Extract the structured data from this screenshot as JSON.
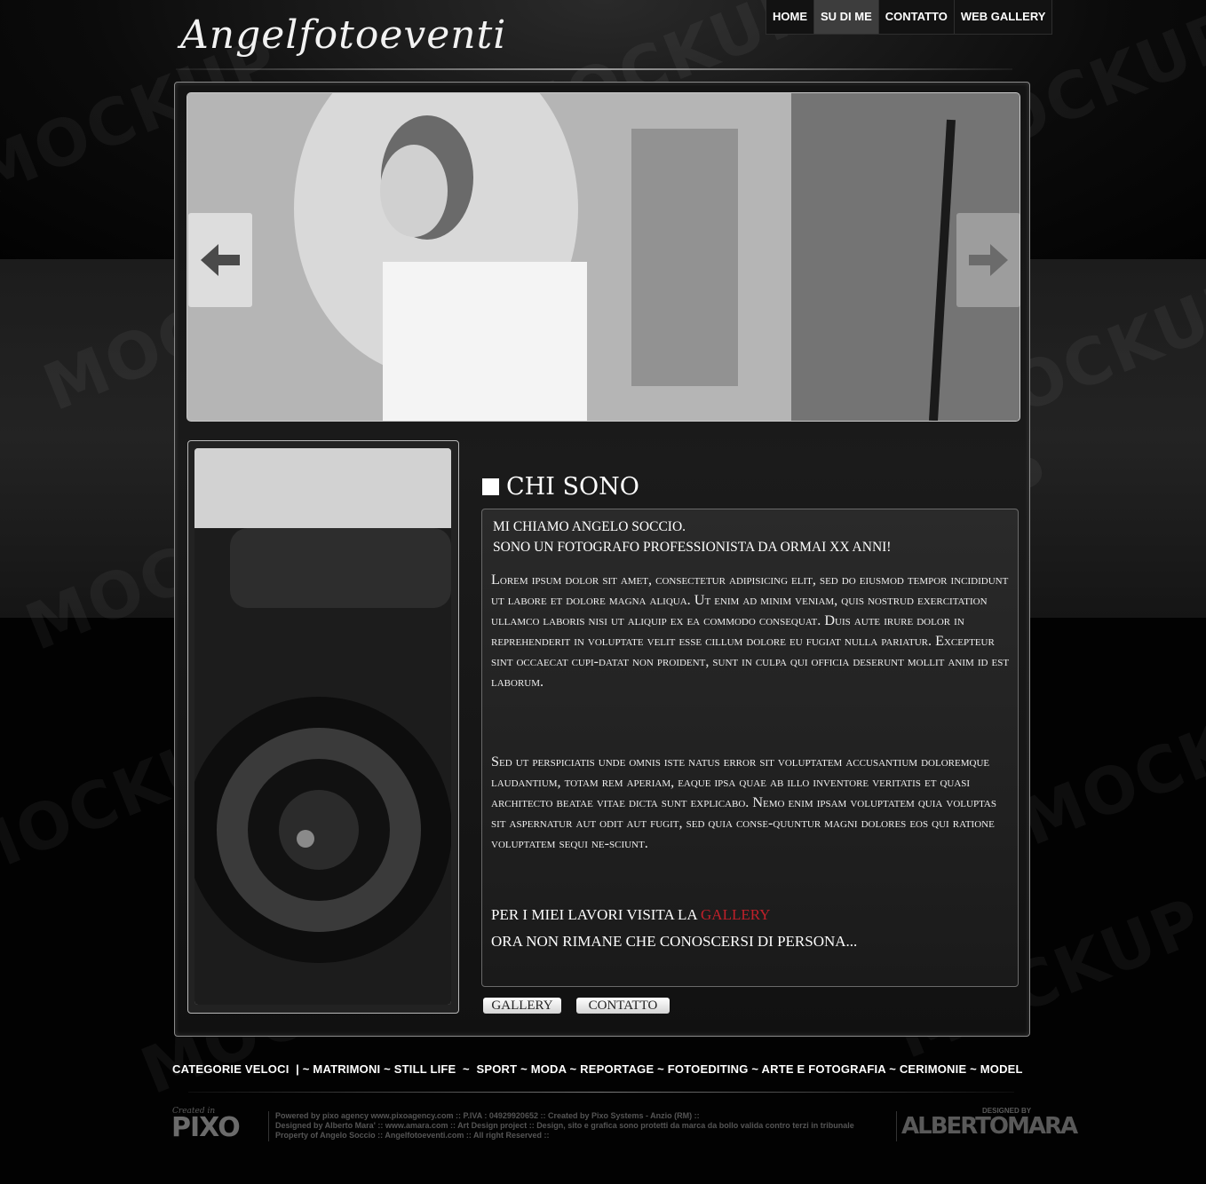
{
  "site": {
    "title": "Angelfotoeventi"
  },
  "nav": {
    "items": [
      {
        "label": "HOME"
      },
      {
        "label": "SU DI ME"
      },
      {
        "label": "CONTATTO"
      },
      {
        "label": "WEB GALLERY"
      }
    ],
    "active": "SU DI ME"
  },
  "watermark": "MOCKUP",
  "content": {
    "title": "CHI SONO",
    "intro_line1": "Mi chiamo Angelo Soccio.",
    "intro_line2": "Sono un fotografo professionista da ormai xx anni!",
    "para1": "Lorem ipsum dolor sit amet, consectetur adipisicing elit, sed do eiusmod tempor incididunt ut labore et dolore magna aliqua. Ut enim ad minim veniam, quis nostrud exercitation ullamco laboris nisi ut aliquip ex ea commodo consequat. Duis aute irure dolor in reprehenderit in voluptate velit esse cillum dolore eu fugiat nulla pariatur. Excepteur sint occaecat cupi-datat non proident, sunt in culpa qui officia deserunt mollit anim id est laborum.",
    "para2": "Sed ut perspiciatis unde omnis iste natus error sit voluptatem accusantium doloremque laudantium, totam rem aperiam, eaque ipsa quae ab illo inventore veritatis et quasi architecto beatae vitae dicta sunt explicabo. Nemo enim ipsam voluptatem quia voluptas sit aspernatur aut odit aut fugit, sed quia conse-quuntur magni dolores eos qui ratione voluptatem sequi ne-sciunt.",
    "gallery_prefix": "Per i miei lavori visita la",
    "gallery_link": "gallery",
    "closing": "Ora non rimane che conoscersi di persona..."
  },
  "buttons": {
    "gallery": "GALLERY",
    "contatto": "CONTATTO"
  },
  "categories": {
    "label": "CATEGORIE VELOCI",
    "separator": "|",
    "items": [
      "MATRIMONI",
      "STILL LIFE",
      "SPORT",
      "MODA",
      "REPORTAGE",
      "FOTOEDITING",
      "ARTE E FOTOGRAFIA",
      "CERIMONIE",
      "MODEL"
    ]
  },
  "footer": {
    "created_in": "Created in",
    "pixo": "PIXO",
    "line1": "Powered by pixo agency  www.pixoagency.com :: P.IVA : 04929920652 :: Created by Pixo Systems - Anzio (RM) ::",
    "line2": "Designed by Alberto Mara' :: www.amara.com :: Art Design project :: Design, sito e grafica sono protetti da marca da bollo valida contro terzi in tribunale",
    "line3": "Property of Angelo Soccio :: Angelfotoeventi.com :: All right Reserved ::",
    "designed_by": "DESIGNED BY",
    "albertomara": "ALBERTOMARA"
  },
  "colors": {
    "link_red": "#c0202a",
    "background": "#020202"
  },
  "icons": {
    "slider_prev": "arrow-left-icon",
    "slider_next": "arrow-right-icon"
  }
}
